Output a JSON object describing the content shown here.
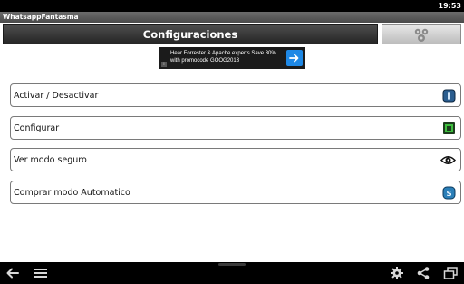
{
  "status_bar": {
    "time": "19:53"
  },
  "app": {
    "title": "WhatsappFantasma"
  },
  "header": {
    "title": "Configuraciones",
    "action_icon": "gears-icon"
  },
  "ad": {
    "text": "Hear Forrester & Apache experts Save 30% with promocode GOOG2013",
    "icon": "arrow-right-icon"
  },
  "menu": {
    "items": [
      {
        "label": "Activar / Desactivar",
        "icon": "power-toggle-icon"
      },
      {
        "label": "Configurar",
        "icon": "green-chip-icon"
      },
      {
        "label": "Ver modo seguro",
        "icon": "eye-icon"
      },
      {
        "label": "Comprar modo Automatico",
        "icon": "dollar-coin-icon"
      }
    ]
  },
  "nav_bar": {
    "icons": [
      "back-icon",
      "menu-icon",
      "settings-icon",
      "share-icon",
      "recent-apps-icon"
    ]
  },
  "colors": {
    "header_bg": "#333333",
    "ad_bg": "#1b1b1b",
    "ad_button": "#1e88e5",
    "item_border": "#7a7a7a",
    "nav_bg": "#000000"
  }
}
